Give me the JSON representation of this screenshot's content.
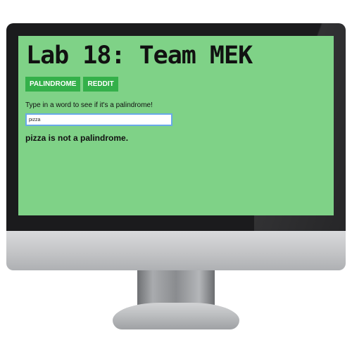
{
  "app": {
    "title": "Lab 18: Team MEK",
    "nav": [
      "PALINDROME",
      "REDDIT"
    ],
    "prompt": "Type in a word to see if it's a palindrome!",
    "input_value": "pizza",
    "result": "pizza is not a palindrome."
  },
  "colors": {
    "screen_bg": "#7fd287",
    "button_bg": "#34b04a",
    "input_border": "#69a9e8"
  }
}
